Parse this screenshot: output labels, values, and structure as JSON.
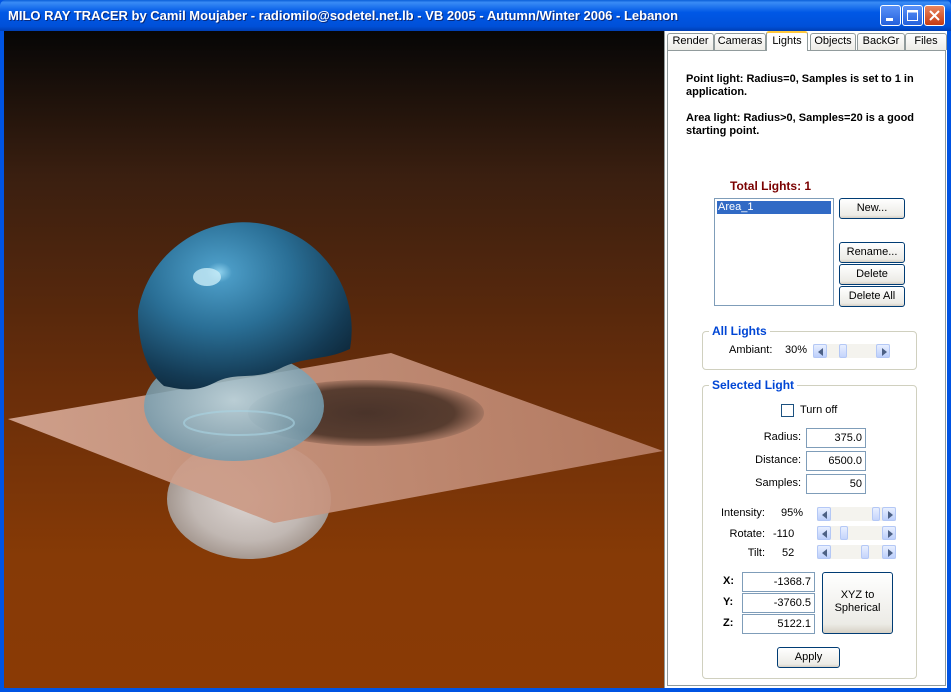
{
  "window": {
    "title": "MILO RAY TRACER by Camil Moujaber - radiomilo@sodetel.net.lb - VB 2005 - Autumn/Winter 2006 - Lebanon"
  },
  "tabs": [
    "Render",
    "Cameras",
    "Lights",
    "Objects",
    "BackGr",
    "Files"
  ],
  "active_tab": "Lights",
  "lights": {
    "info_point": "Point light: Radius=0, Samples is set to 1 in application.",
    "info_area": "Area light: Radius>0, Samples=20 is a good starting point.",
    "total_label": "Total Lights: 1",
    "list_items": [
      "Area_1"
    ],
    "buttons": {
      "new": "New...",
      "rename": "Rename...",
      "delete": "Delete",
      "delete_all": "Delete All"
    }
  },
  "all_lights": {
    "title": "All Lights",
    "ambiant_label": "Ambiant:",
    "ambiant_value": "30%",
    "ambiant_level": 0.3
  },
  "selected_light": {
    "title": "Selected Light",
    "turn_off_label": "Turn off",
    "turn_off_checked": false,
    "radius_label": "Radius:",
    "radius_value": "375.0",
    "distance_label": "Distance:",
    "distance_value": "6500.0",
    "samples_label": "Samples:",
    "samples_value": "50",
    "intensity_label": "Intensity:",
    "intensity_value": "95%",
    "intensity_level": 0.95,
    "rotate_label": "Rotate:",
    "rotate_value": "-110",
    "rotate_level": 0.2,
    "tilt_label": "Tilt:",
    "tilt_value": "52",
    "tilt_level": 0.7,
    "x_label": "X:",
    "x_value": "-1368.7",
    "y_label": "Y:",
    "y_value": "-3760.5",
    "z_label": "Z:",
    "z_value": "5122.1",
    "xyz_button": "XYZ to Spherical",
    "apply_button": "Apply"
  },
  "colors": {
    "titlebar": "#0058e6",
    "group_title": "#0046d5",
    "total_lights": "#7a0000",
    "selection": "#316ac5",
    "sphere": "#2a6f96",
    "floor_plane": "#c8907c"
  },
  "icons": {
    "minimize": "minimize-icon",
    "maximize": "maximize-icon",
    "close": "close-icon"
  }
}
